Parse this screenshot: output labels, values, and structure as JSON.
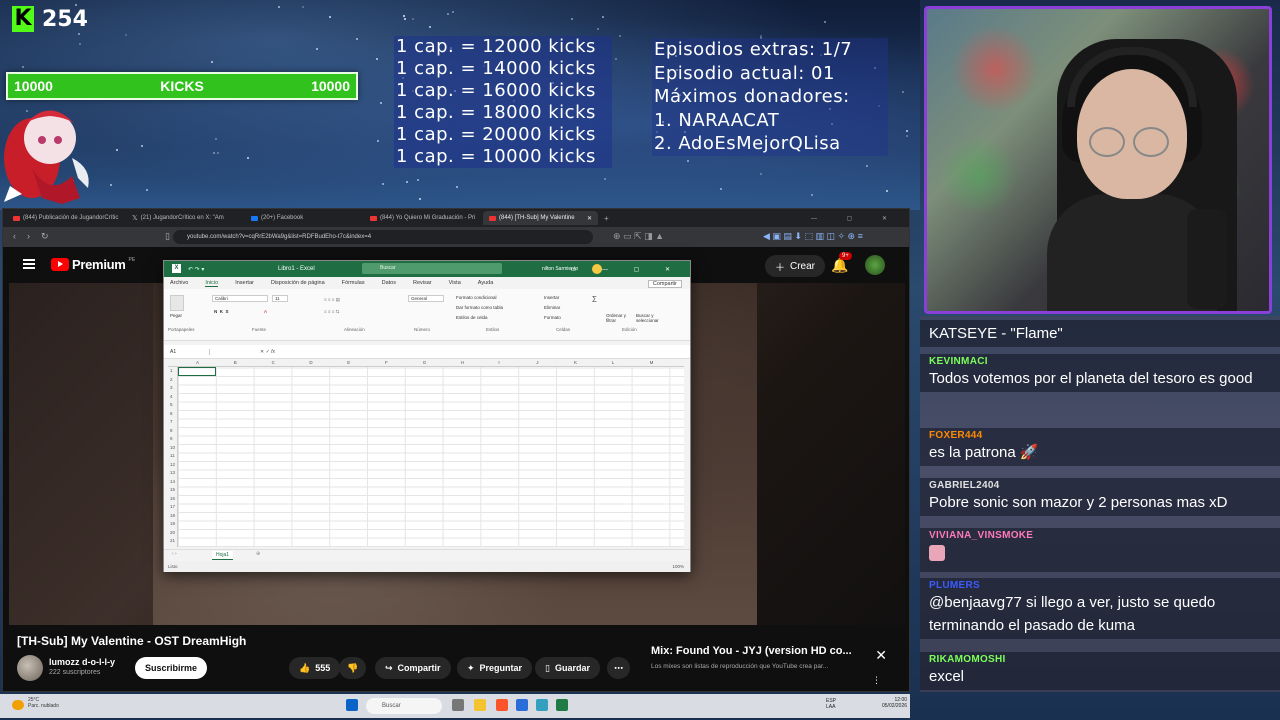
{
  "kick": {
    "count": "254",
    "bar_left": "10000",
    "bar_label": "KICKS",
    "bar_right": "10000",
    "bar_fill_fraction": 1.0
  },
  "caps": [
    "1 cap. = 12000 kicks",
    "1 cap. = 14000 kicks",
    "1 cap. = 16000 kicks",
    "1 cap. = 18000 kicks",
    "1 cap. = 20000 kicks",
    "1 cap. = 10000 kicks"
  ],
  "episodes": [
    "Episodios extras: 1/7",
    "Episodio actual: 01",
    "Máximos donadores:",
    "1. NARAACAT",
    "2. AdoEsMejorQLisa"
  ],
  "chat": [
    {
      "user": "",
      "color": "#ffffff",
      "msg": "KATSEYE - \"Flame\""
    },
    {
      "user": "KEVINMACI",
      "color": "#7cff5a",
      "msg": "Todos votemos por el planeta del tesoro es good"
    },
    {
      "user": "FOXER444",
      "color": "#ff8a00",
      "msg": "es la patrona 🚀"
    },
    {
      "user": "GABRIEL2404",
      "color": "#e0e0e0",
      "msg": "Pobre sonic son mazor y 2 personas mas xD"
    },
    {
      "user": "VIVIANA_VINSMOKE",
      "color": "#ff7ab6",
      "msg": ""
    },
    {
      "user": "PLUMERS",
      "color": "#3b5bff",
      "msg": "@benjaavg77 si llego a ver, justo se quedo terminando el pasado de kuma"
    },
    {
      "user": "RIKAMOMOSHI",
      "color": "#7cff5a",
      "msg": "excel"
    }
  ],
  "browser": {
    "tabs": [
      {
        "label": "(844) Publicación de JugandorCrític",
        "active": false
      },
      {
        "label": "(21) JugandorCrítico en X: \"Am",
        "active": false
      },
      {
        "label": "(20+) Facebook",
        "active": false
      },
      {
        "label": "(844) Yo Quiero Mi Graduación - Pri",
        "active": false
      },
      {
        "label": "(844) [TH-Sub] My Valentine",
        "active": true
      }
    ],
    "url": "youtube.com/watch?v=cqRrE2bWa9g&list=RDFBudEho-t7c&index=4"
  },
  "youtube": {
    "logo": "Premium",
    "region": "PE",
    "create": "Crear",
    "notif_count": "9+",
    "video_title": "[TH-Sub] My Valentine - OST DreamHigh",
    "channel": "lumozz d-o-l-l-y",
    "subs": "222 suscriptores",
    "subscribe": "Suscribirme",
    "likes": "555",
    "share": "Compartir",
    "ask": "Preguntar",
    "save": "Guardar",
    "mix_title": "Mix: Found You - JYJ (version HD co...",
    "mix_desc": "Los mixes son listas de reproducción que YouTube crea par..."
  },
  "excel": {
    "title": "Libro1 - Excel",
    "search": "Buscar",
    "user": "nilton Sarmiento",
    "menu": [
      "Archivo",
      "Inicio",
      "Insertar",
      "Disposición de página",
      "Fórmulas",
      "Datos",
      "Revisar",
      "Vista",
      "Ayuda"
    ],
    "share": "Compartir",
    "groups": [
      "Portapapeles",
      "Fuente",
      "Alineación",
      "Número",
      "Estilos",
      "Celdas",
      "Edición"
    ],
    "font": "Calibri",
    "font_size": "11",
    "number_format": "General",
    "cond_format": "Formato condicional",
    "table_format": "Dar formato como tabla",
    "cell_styles": "Estilos de celda",
    "insert": "Insertar",
    "delete": "Eliminar",
    "format": "Formato",
    "sort": "Ordenar y filtrar",
    "find": "Buscar y seleccionar",
    "paste": "Pegar",
    "name_box": "A1",
    "columns": [
      "A",
      "B",
      "C",
      "D",
      "E",
      "F",
      "G",
      "H",
      "I",
      "J",
      "K",
      "L",
      "M"
    ],
    "rows": [
      "1",
      "2",
      "3",
      "4",
      "5",
      "6",
      "7",
      "8",
      "9",
      "10",
      "11",
      "12",
      "13",
      "14",
      "15",
      "16",
      "17",
      "18",
      "19",
      "20",
      "21"
    ],
    "sheet": "Hoja1",
    "status": "Listo",
    "zoom": "100%"
  },
  "taskbar": {
    "weather_temp": "25°C",
    "weather_desc": "Parc. nublado",
    "search": "Buscar",
    "lang": "ESP",
    "lang2": "LAA",
    "time": "12:00",
    "date": "05/02/2026"
  }
}
